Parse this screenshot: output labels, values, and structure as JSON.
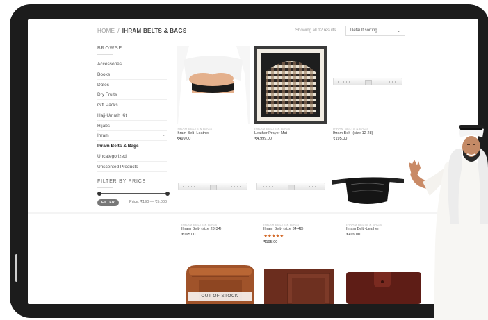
{
  "breadcrumb": {
    "home": "HOME",
    "separator": "/",
    "current": "IHRAM BELTS & BAGS"
  },
  "results": {
    "showing": "Showing all 12 results",
    "sort": "Default sorting"
  },
  "sidebar": {
    "browse_title": "BROWSE",
    "categories": [
      {
        "label": "Accessories"
      },
      {
        "label": "Books"
      },
      {
        "label": "Dates"
      },
      {
        "label": "Dry Fruits"
      },
      {
        "label": "Gift Packs"
      },
      {
        "label": "Hajj-Umrah Kit"
      },
      {
        "label": "Hijabs"
      },
      {
        "label": "Ihram"
      },
      {
        "label": "Ihram Belts & Bags"
      },
      {
        "label": "Uncategorized"
      },
      {
        "label": "Unscented Products"
      }
    ],
    "active_category": "Ihram Belts & Bags",
    "filter_title": "FILTER BY PRICE",
    "filter_button": "FILTER",
    "price_range": "Price: ₹190 — ₹5,000"
  },
  "products": [
    {
      "category": "IHRAM BELTS & BAGS",
      "name": "Ihram Belt -Leather",
      "price": "₹499.00"
    },
    {
      "category": "IHRAM BELTS & BAGS",
      "name": "Leather Prayer Mat",
      "price": "₹4,999.00"
    },
    {
      "category": "IHRAM BELTS & BAGS",
      "name": "Ihram Belt- (size 12-28)",
      "price": "₹195.00"
    },
    {
      "category": "IHRAM BELTS & BAGS",
      "name": "Ihram Belt- (size 28-34)",
      "price": "₹195.00"
    },
    {
      "category": "IHRAM BELTS & BAGS",
      "name": "Ihram Belt- (size 34-48)",
      "price": "₹195.00",
      "rating": 5,
      "stars": "★★★★★"
    },
    {
      "category": "IHRAM BELTS & BAGS",
      "name": "Ihram Belt -Leather",
      "price": "₹499.00"
    }
  ],
  "out_of_stock_label": "OUT OF STOCK",
  "colors": {
    "star": "#d36b2b",
    "filter_button": "#777777",
    "tablet_frame": "#1c1c1c"
  }
}
